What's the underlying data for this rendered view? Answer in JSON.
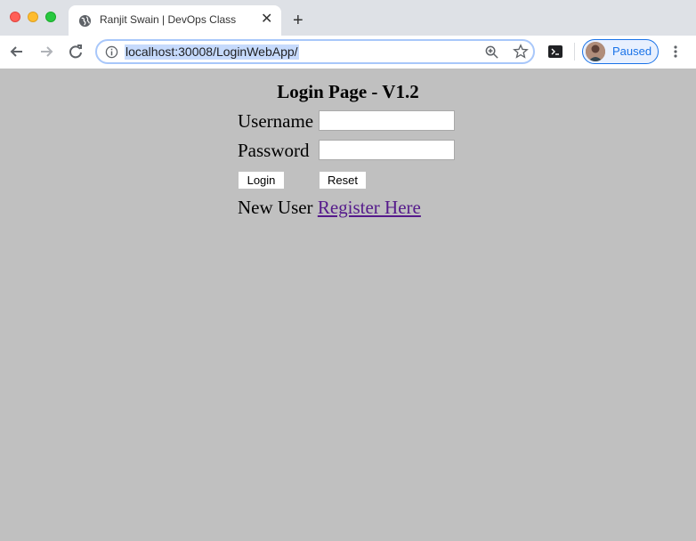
{
  "browser": {
    "tab_title": "Ranjit Swain | DevOps Class",
    "url": "localhost:30008/LoginWebApp/",
    "profile_label": "Paused"
  },
  "login": {
    "heading": "Login Page - V1.2",
    "username_label": "Username",
    "username_value": "",
    "password_label": "Password",
    "password_value": "",
    "login_button": "Login",
    "reset_button": "Reset",
    "new_user_text": "New User",
    "register_link": "Register Here"
  },
  "colors": {
    "page_background": "#c0c0c0",
    "link_visited": "#551a8b",
    "profile_accent": "#1a73e8"
  }
}
